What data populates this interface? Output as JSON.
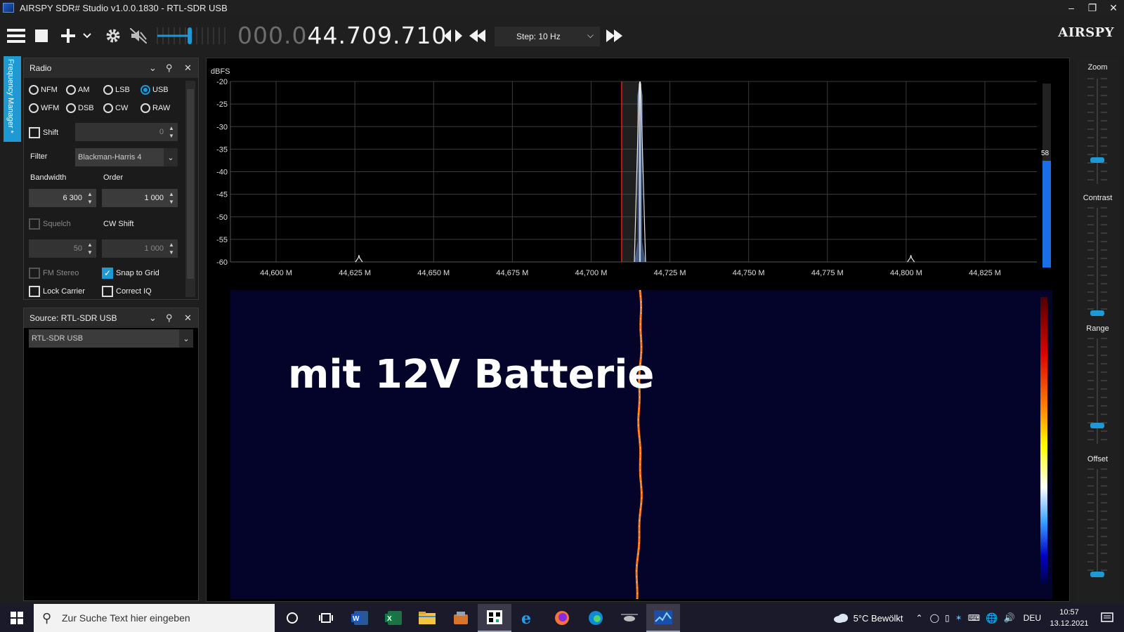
{
  "window": {
    "title": "AIRSPY SDR# Studio v1.0.0.1830 - RTL-SDR USB",
    "minimize": "–",
    "restore": "❐",
    "close": "✕"
  },
  "toolbar": {
    "frequency_dim": "000.0",
    "frequency_bright": "44.709.710",
    "step_label": "Step: 10 Hz",
    "brand": "AIRSPY",
    "volume_level": 0.48
  },
  "side_tab": {
    "label": "Frequency Manager *"
  },
  "radio_panel": {
    "title": "Radio",
    "modes": [
      {
        "label": "NFM",
        "selected": false
      },
      {
        "label": "AM",
        "selected": false
      },
      {
        "label": "LSB",
        "selected": false
      },
      {
        "label": "USB",
        "selected": true
      },
      {
        "label": "WFM",
        "selected": false
      },
      {
        "label": "DSB",
        "selected": false
      },
      {
        "label": "CW",
        "selected": false
      },
      {
        "label": "RAW",
        "selected": false
      }
    ],
    "shift_label": "Shift",
    "shift_value": "0",
    "filter_label": "Filter",
    "filter_value": "Blackman-Harris 4",
    "bandwidth_label": "Bandwidth",
    "bandwidth_value": "6 300",
    "order_label": "Order",
    "order_value": "1 000",
    "squelch_label": "Squelch",
    "squelch_value": "50",
    "cw_shift_label": "CW Shift",
    "cw_shift_value": "1 000",
    "fm_stereo_label": "FM Stereo",
    "snap_label": "Snap to Grid",
    "lock_carrier_label": "Lock Carrier",
    "correct_iq_label": "Correct IQ"
  },
  "source_panel": {
    "title": "Source: RTL-SDR USB",
    "device": "RTL-SDR USB"
  },
  "spectrum": {
    "unit": "dBFS",
    "overlay_text": "mit 12V Batterie",
    "level_value": "58",
    "level_fraction": 0.58
  },
  "chart_data": {
    "type": "line",
    "ylabel": "dBFS",
    "ylim": [
      -60,
      -20
    ],
    "yticks": [
      "-20",
      "-25",
      "-30",
      "-35",
      "-40",
      "-45",
      "-50",
      "-55",
      "-60"
    ],
    "xlim": [
      44.5855,
      44.8415
    ],
    "xticks": [
      {
        "v": 44.6,
        "label": "44,600 M"
      },
      {
        "v": 44.625,
        "label": "44,625 M"
      },
      {
        "v": 44.65,
        "label": "44,650 M"
      },
      {
        "v": 44.675,
        "label": "44,675 M"
      },
      {
        "v": 44.7,
        "label": "44,700 M"
      },
      {
        "v": 44.725,
        "label": "44,725 M"
      },
      {
        "v": 44.75,
        "label": "44,750 M"
      },
      {
        "v": 44.775,
        "label": "44,775 M"
      },
      {
        "v": 44.8,
        "label": "44,800 M"
      },
      {
        "v": 44.825,
        "label": "44,825 M"
      }
    ],
    "grid": true,
    "signal_peaks": [
      {
        "x": 44.6263,
        "y": -58.5
      },
      {
        "x": 44.7155,
        "y": -20
      },
      {
        "x": 44.8015,
        "y": -58.5
      }
    ],
    "vfo_band": [
      44.7097,
      44.716
    ]
  },
  "right_panel": {
    "zoom_label": "Zoom",
    "contrast_label": "Contrast",
    "range_label": "Range",
    "offset_label": "Offset"
  },
  "taskbar": {
    "search_placeholder": "Zur Suche Text hier eingeben",
    "weather": "5°C  Bewölkt",
    "language": "DEU",
    "time": "10:57",
    "date": "13.12.2021"
  }
}
